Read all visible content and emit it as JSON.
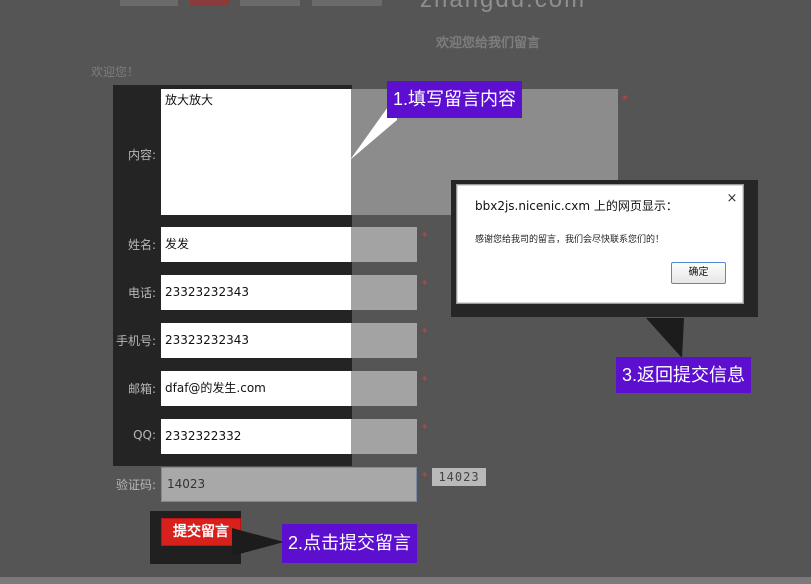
{
  "header": {
    "logo_text": "zhangdu.com",
    "page_heading": "欢迎您给我们留言",
    "welcome": "欢迎您！"
  },
  "form": {
    "content": {
      "label": "内容:",
      "value": "放大放大"
    },
    "name": {
      "label": "姓名:",
      "value": "发发"
    },
    "phone": {
      "label": "电话:",
      "value": "23323232343"
    },
    "mobile": {
      "label": "手机号:",
      "value": "23323232343"
    },
    "email": {
      "label": "邮箱:",
      "value": "dfaf@的发生.com"
    },
    "qq": {
      "label": "QQ:",
      "value": "2332322332"
    },
    "captcha": {
      "label": "验证码:",
      "value": "14023",
      "code_image": "14023"
    },
    "required_mark": "*",
    "submit_label": "提交留言"
  },
  "callouts": {
    "step1": "1.填写留言内容",
    "step2": "2.点击提交留言",
    "step3": "3.返回提交信息"
  },
  "dialog": {
    "title": "bbx2js.nicenic.cxm 上的网页显示：",
    "message": "感谢您给我司的留言，我们会尽快联系您们的！",
    "ok_label": "确定",
    "close_symbol": "×"
  },
  "colors": {
    "callout_purple": "#5c0fcf",
    "submit_red": "#d8201c",
    "background": "#555555"
  }
}
